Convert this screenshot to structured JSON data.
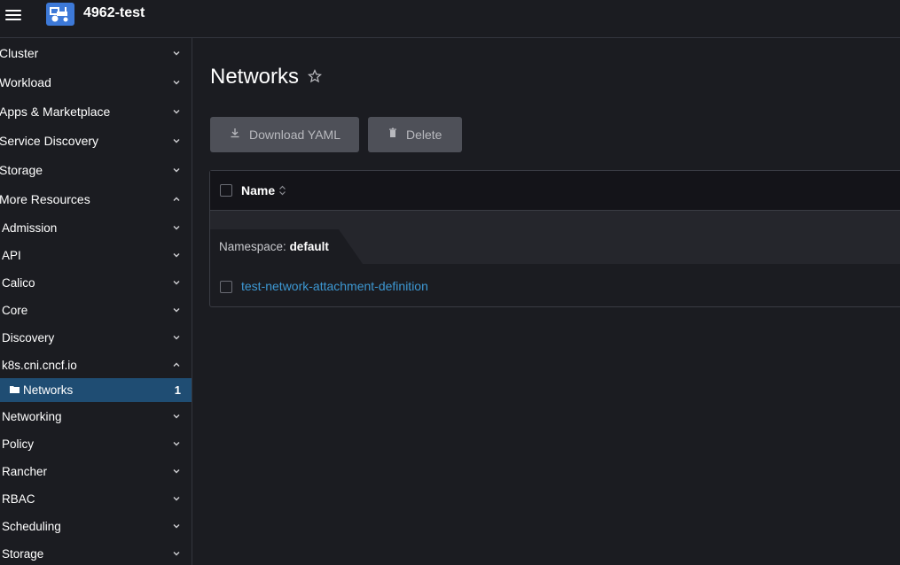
{
  "header": {
    "cluster_name": "4962-test",
    "logo_icon": "tractor-icon",
    "accent_color": "#3d79d8"
  },
  "sidebar": {
    "groups": [
      {
        "label": "Cluster",
        "expanded": false
      },
      {
        "label": "Workload",
        "expanded": false
      },
      {
        "label": "Apps & Marketplace",
        "expanded": false
      },
      {
        "label": "Service Discovery",
        "expanded": false
      },
      {
        "label": "Storage",
        "expanded": false
      },
      {
        "label": "More Resources",
        "expanded": true
      }
    ],
    "sub_groups": [
      {
        "label": "Admission",
        "expanded": false
      },
      {
        "label": "API",
        "expanded": false
      },
      {
        "label": "Calico",
        "expanded": false
      },
      {
        "label": "Core",
        "expanded": false
      },
      {
        "label": "Discovery",
        "expanded": false
      },
      {
        "label": "k8s.cni.cncf.io",
        "expanded": true
      }
    ],
    "active_item": {
      "label": "Networks",
      "count": "1",
      "icon": "folder-icon"
    },
    "sub_groups_after": [
      {
        "label": "Networking",
        "expanded": false
      },
      {
        "label": "Policy",
        "expanded": false
      },
      {
        "label": "Rancher",
        "expanded": false
      },
      {
        "label": "RBAC",
        "expanded": false
      },
      {
        "label": "Scheduling",
        "expanded": false
      },
      {
        "label": "Storage",
        "expanded": false
      }
    ]
  },
  "main": {
    "title": "Networks",
    "buttons": {
      "download_yaml": "Download YAML",
      "delete": "Delete"
    },
    "table": {
      "columns": [
        "Name"
      ],
      "namespace_label": "Namespace:",
      "namespace_value": "default",
      "rows": [
        {
          "name": "test-network-attachment-definition"
        }
      ]
    }
  }
}
